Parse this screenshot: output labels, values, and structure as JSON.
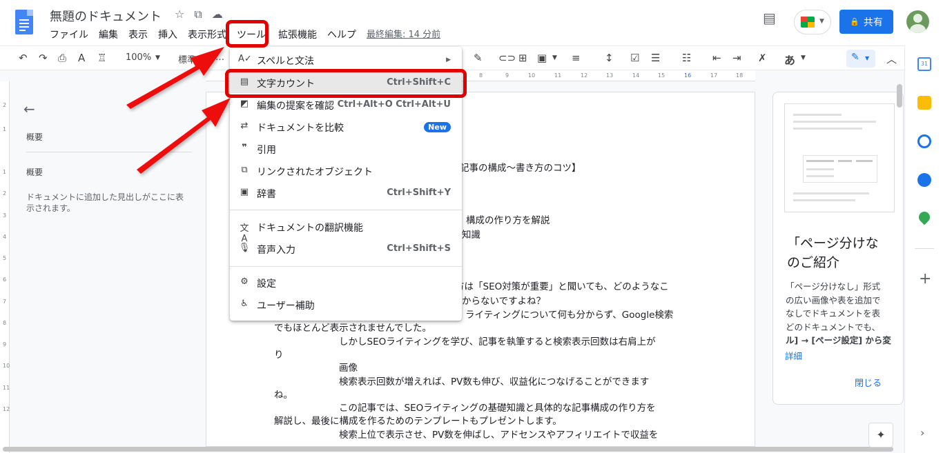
{
  "header": {
    "doc_title": "無題のドキュメント",
    "menu": [
      "ファイル",
      "編集",
      "表示",
      "挿入",
      "表示形式",
      "ツール",
      "拡張機能",
      "ヘルプ"
    ],
    "last_edit": "最終編集: 14 分前",
    "share_label": "共有"
  },
  "toolbar": {
    "zoom": "100%",
    "style": "標準",
    "style_trunc": "…",
    "input_char": "あ"
  },
  "ruler_numbers": [
    "8",
    "9",
    "10",
    "11",
    "12",
    "13",
    "14",
    "15",
    "16",
    "17",
    "18"
  ],
  "vruler_numbers": [
    "2",
    "1",
    "1",
    "2",
    "3",
    "4",
    "5",
    "6",
    "7",
    "8",
    "9",
    "10",
    "11",
    "12"
  ],
  "outline": {
    "heading1": "概要",
    "heading2": "概要",
    "empty_text": "ドキュメントに追加した見出しがここに表示されます。"
  },
  "tools_menu": {
    "items": [
      {
        "icon": "spelling-icon",
        "label": "スペルと文法",
        "shortcut": "",
        "submenu": true
      },
      {
        "icon": "word-count-icon",
        "label": "文字カウント",
        "shortcut": "Ctrl+Shift+C"
      },
      {
        "icon": "review-suggestions-icon",
        "label": "編集の提案を確認",
        "shortcut": "Ctrl+Alt+O Ctrl+Alt+U"
      },
      {
        "icon": "compare-icon",
        "label": "ドキュメントを比較",
        "badge": "New"
      },
      {
        "icon": "citation-icon",
        "label": "引用",
        "shortcut": ""
      },
      {
        "icon": "linked-objects-icon",
        "label": "リンクされたオブジェクト",
        "shortcut": ""
      },
      {
        "icon": "dictionary-icon",
        "label": "辞書",
        "shortcut": "Ctrl+Shift+Y"
      },
      {
        "icon": "translate-icon",
        "label": "ドキュメントの翻訳機能",
        "shortcut": ""
      },
      {
        "icon": "microphone-icon",
        "label": "音声入力",
        "shortcut": "Ctrl+Shift+S"
      },
      {
        "icon": "settings-icon",
        "label": "設定",
        "shortcut": ""
      },
      {
        "icon": "accessibility-icon",
        "label": "ユーザー補助",
        "shortcut": ""
      }
    ]
  },
  "doc": {
    "lines": [
      "記事の構成～書き方のコツ】",
      "グ、構成の作り方を解説",
      "知識",
      "方は「SEO対策が重要」と聞いても、どのようなこ",
      "からないですよね？",
      "ライティングについて何も分からず、Google検索",
      "でもほとんど表示されませんでした。",
      "しかしSEOライティングを学び、記事を執筆すると検索表示回数は右肩上が",
      "り",
      "画像",
      "検索表示回数が増えれば、PV数も伸び、収益化につなげることができます",
      "ね。",
      "この記事では、SEOライティングの基礎知識と具体的な記事構成の作り方を",
      "解説し、最後に構成を作るためのテンプレートもプレゼントします。",
      "検索上位で表示させ、PV数を伸ばし、アドセンスやアフィリエイトで収益を"
    ]
  },
  "side_card": {
    "title": "「ページ分けなしのご紹介",
    "title_line1": "「ページ分けな",
    "title_line2": "のご紹介",
    "text1": "「ページ分けなし」形式",
    "text2": "の広い画像や表を追加で",
    "text3": "なしでドキュメントを表",
    "text4": "どのドキュメントでも、",
    "text5": "ル] → [ページ設定] から変",
    "link": "詳細",
    "close": "閉じる"
  },
  "colors": {
    "highlight_red": "#e00000",
    "accent_blue": "#1a73e8"
  }
}
